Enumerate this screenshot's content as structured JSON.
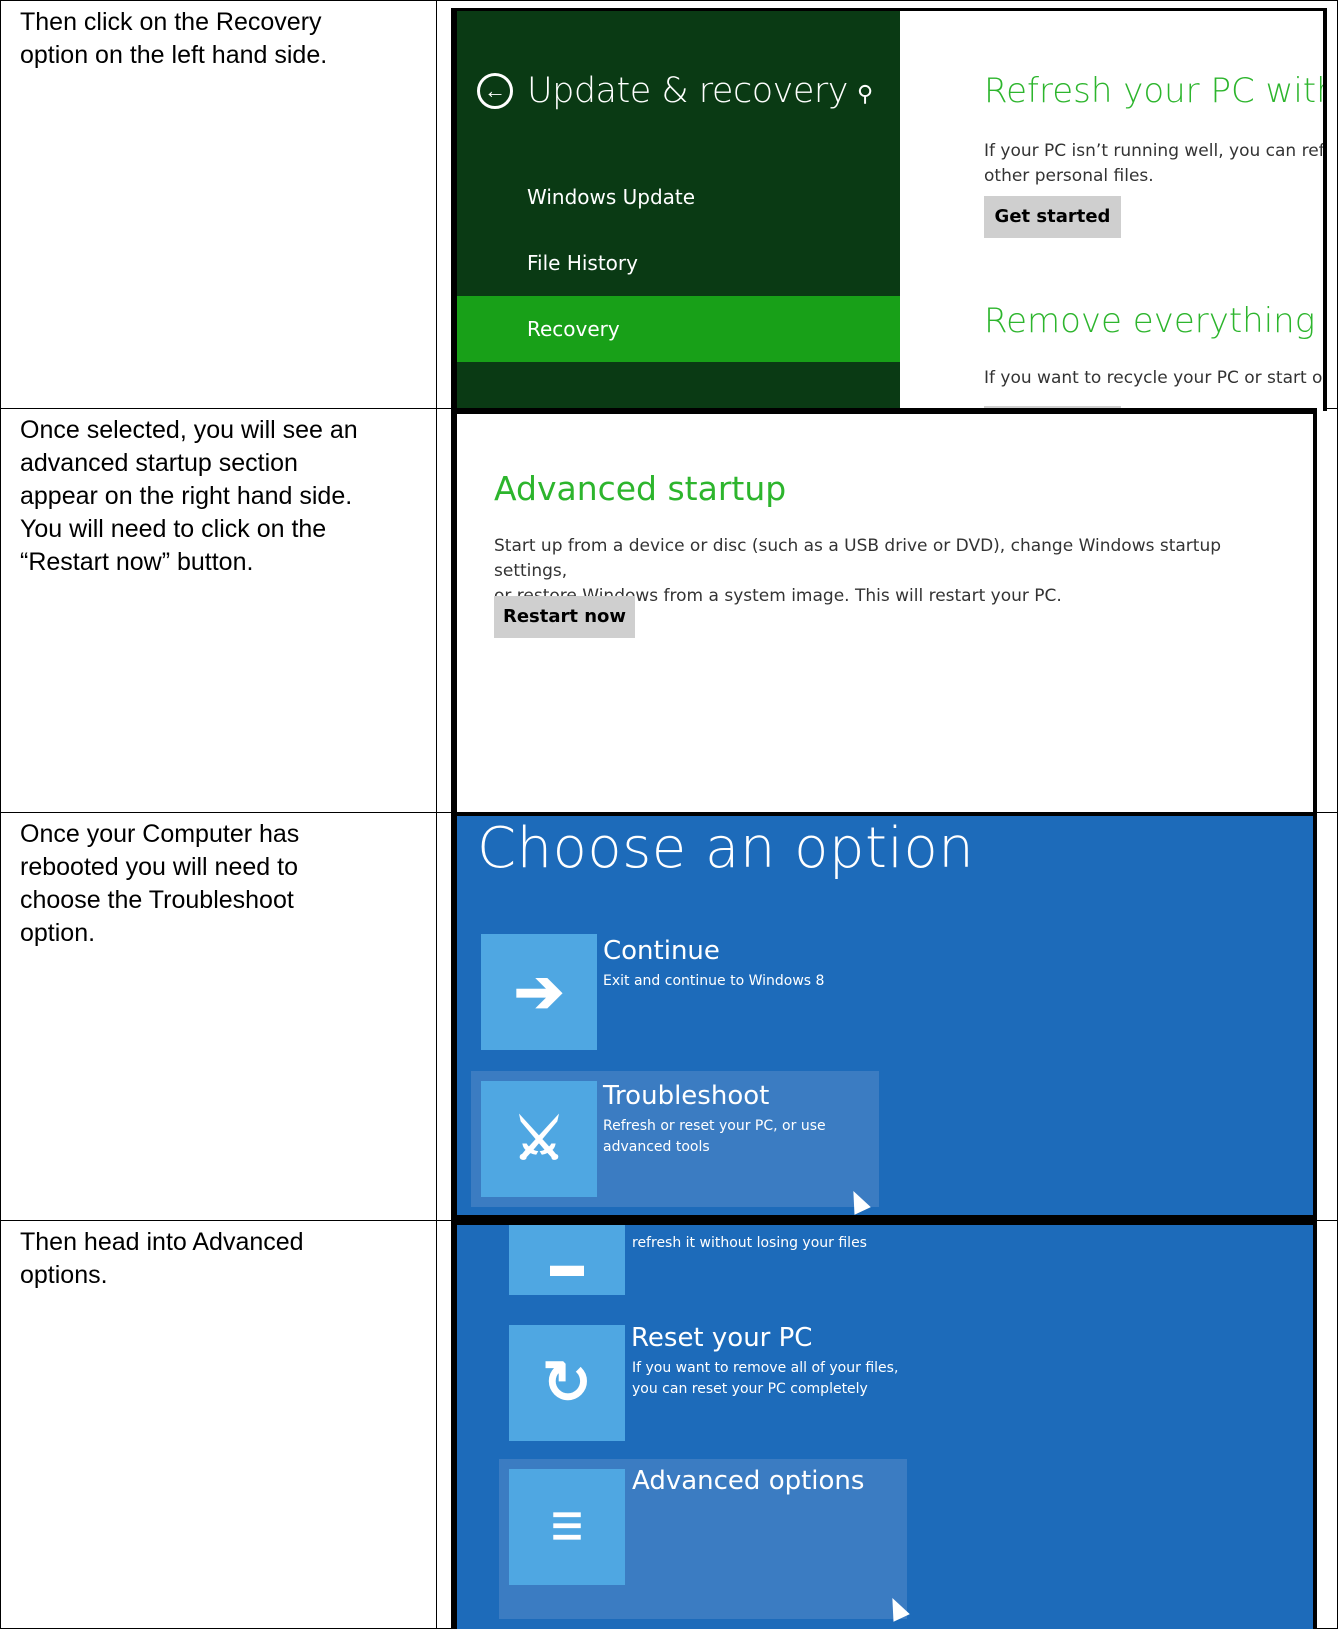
{
  "steps": [
    {
      "instruction": "Then click on the Recovery\noption on the left hand side."
    },
    {
      "instruction": "Once selected, you will see an\nadvanced startup section\nappear on the right hand side.\nYou will need to click on the\n“Restart now” button."
    },
    {
      "instruction": "Once your Computer has\nrebooted you will need to\nchoose the Troubleshoot\noption."
    },
    {
      "instruction": "Then head into Advanced\noptions."
    }
  ],
  "settings_panel": {
    "title": "Update & recovery",
    "back_icon": "back-arrow-icon",
    "search_icon": "search-icon",
    "nav": [
      {
        "label": "Windows Update",
        "active": false
      },
      {
        "label": "File History",
        "active": false
      },
      {
        "label": "Recovery",
        "active": true
      }
    ],
    "refresh_heading": "Refresh your PC withou",
    "refresh_text": "If your PC isn’t running well, you can refr\nother personal files.",
    "get_started_label": "Get started",
    "remove_heading": "Remove everything anc",
    "remove_text": "If you want to recycle your PC or start ov",
    "colors": {
      "sidebar": "#0a3a14",
      "active": "#18a018",
      "accent": "#2db52d"
    }
  },
  "advanced_startup": {
    "heading": "Advanced startup",
    "text": "Start up from a device or disc (such as a USB drive or DVD), change Windows startup settings,\nor restore Windows from a system image. This will restart your PC.",
    "button_label": "Restart now"
  },
  "choose_option": {
    "title": "Choose an option",
    "options": [
      {
        "title": "Continue",
        "subtitle": "Exit and continue to Windows 8",
        "icon": "arrow-right-icon"
      },
      {
        "title": "Troubleshoot",
        "subtitle": "Refresh or reset your PC, or use\nadvanced tools",
        "icon": "tools-icon",
        "highlighted": true
      }
    ],
    "background": "#1d6bba"
  },
  "troubleshoot": {
    "partial_text": "refresh it without losing your files",
    "options": [
      {
        "title": "Reset your PC",
        "subtitle": "If you want to remove all of your files,\nyou can reset your PC completely",
        "icon": "reset-icon"
      },
      {
        "title": "Advanced options",
        "subtitle": "",
        "icon": "checklist-icon",
        "highlighted": true
      }
    ]
  }
}
